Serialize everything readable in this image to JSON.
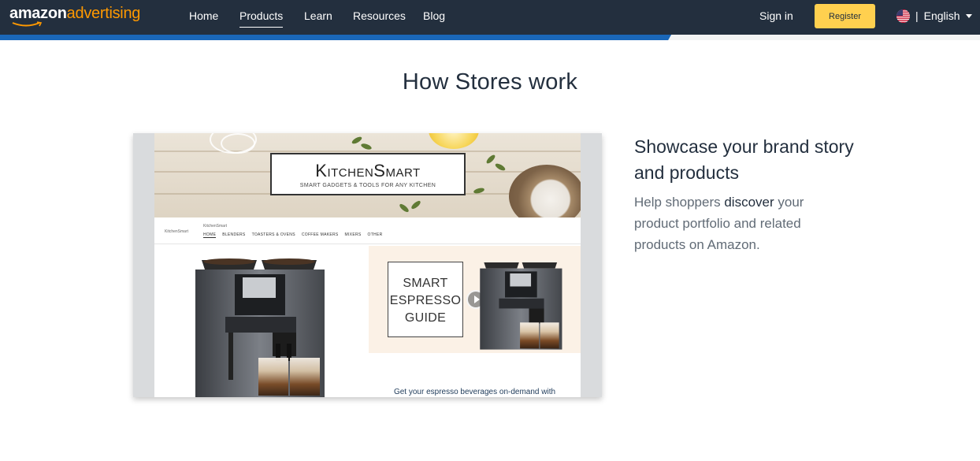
{
  "nav": {
    "logo_part1": "amazon",
    "logo_part2": "advertising",
    "links": [
      "Home",
      "Products",
      "Learn",
      "Resources",
      "Blog"
    ],
    "active": "Products",
    "sign_in": "Sign in",
    "register": "Register",
    "language_separator": "|",
    "language": "English",
    "flag_icon": "us-flag-icon",
    "scroll_progress": 0.685
  },
  "section": {
    "title": "How Stores work"
  },
  "preview": {
    "brand_name": "KitchenSmart",
    "brand_tagline": "SMART GADGETS & TOOLS FOR ANY KITCHEN",
    "mini_logo": "KitchenSmart",
    "mini_brand": "KitchenSmart",
    "mini_nav": [
      "HOME",
      "BLENDERS",
      "TOASTERS & OVENS",
      "COFFEE MAKERS",
      "MIXERS",
      "OTHER"
    ],
    "guide_lines": [
      "SMART",
      "ESPRESSO",
      "GUIDE"
    ],
    "caption": "Get your espresso beverages on-demand with"
  },
  "copy": {
    "heading": "Showcase your brand story and products",
    "body_pre": "Help shoppers ",
    "body_bold": "discover",
    "body_post": " your product portfolio and related products on Amazon."
  },
  "colors": {
    "nav_bg": "#232f3e",
    "brand_orange": "#ff9900",
    "register_bg": "#ffd04f",
    "progress_blue": "#1a67b8"
  }
}
